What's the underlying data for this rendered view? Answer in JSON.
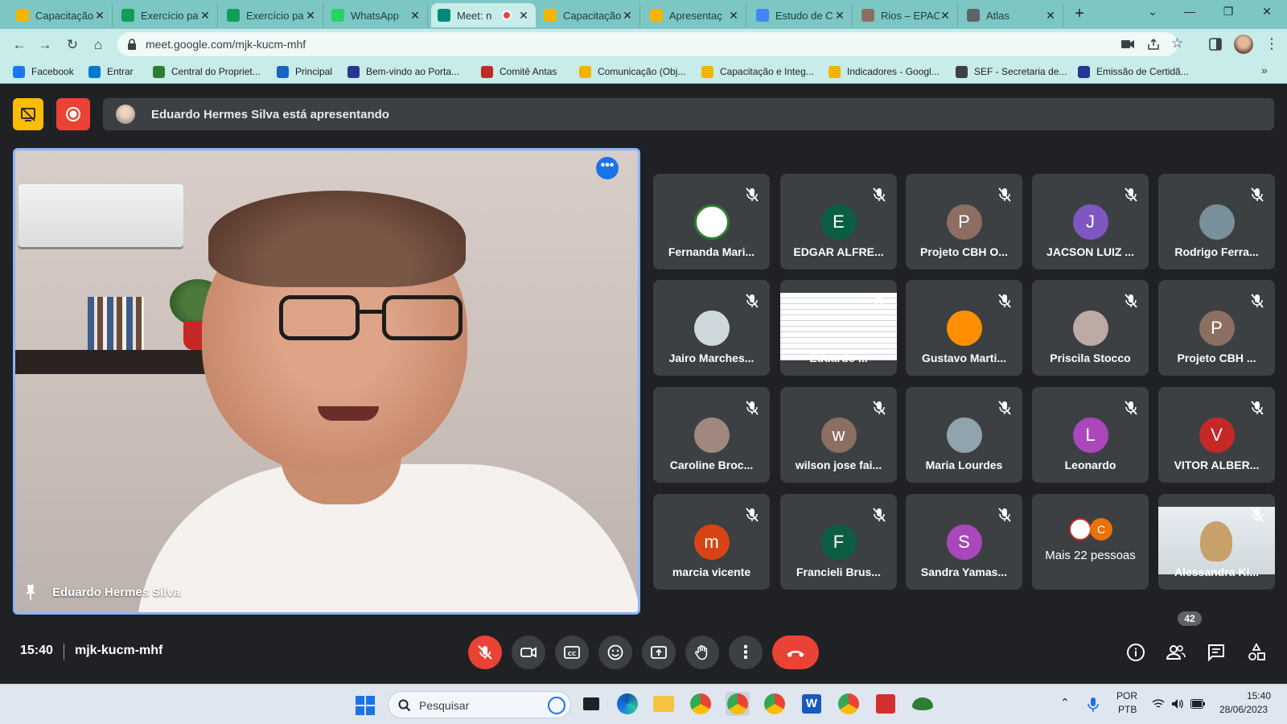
{
  "browser": {
    "tabs": [
      {
        "label": "Capacitação",
        "icon": "google-drive-icon",
        "color": "#f4b400"
      },
      {
        "label": "Exercício pa",
        "icon": "google-sheets-icon",
        "color": "#0f9d58"
      },
      {
        "label": "Exercício pa",
        "icon": "google-sheets-icon",
        "color": "#0f9d58"
      },
      {
        "label": "WhatsApp",
        "icon": "whatsapp-icon",
        "color": "#25d366"
      },
      {
        "label": "Meet: n",
        "icon": "google-meet-icon",
        "color": "#00897b"
      },
      {
        "label": "Capacitação",
        "icon": "google-drive-icon",
        "color": "#f4b400"
      },
      {
        "label": "Apresentaç",
        "icon": "google-slides-icon",
        "color": "#f4b400"
      },
      {
        "label": "Estudo de C",
        "icon": "google-docs-icon",
        "color": "#4285f4"
      },
      {
        "label": "Rios – EPAC",
        "icon": "site-icon",
        "color": "#8d6e63"
      },
      {
        "label": "Atlas",
        "icon": "globe-icon",
        "color": "#5f6368"
      }
    ],
    "url": "meet.google.com/mjk-kucm-mhf",
    "bookmarks": [
      {
        "label": "Facebook",
        "icon": "facebook-icon",
        "color": "#1877f2"
      },
      {
        "label": "Entrar",
        "icon": "outlook-icon",
        "color": "#0078d4"
      },
      {
        "label": "Central do Propriet...",
        "icon": "shield-icon",
        "color": "#2e7d32"
      },
      {
        "label": "Principal",
        "icon": "bird-icon",
        "color": "#1565c0"
      },
      {
        "label": "Bem-vindo ao Porta...",
        "icon": "portal-icon",
        "color": "#283593"
      },
      {
        "label": "Comitê Antas",
        "icon": "antas-icon",
        "color": "#c62828"
      },
      {
        "label": "Comunicação (Obj...",
        "icon": "google-drive-icon",
        "color": "#f4b400"
      },
      {
        "label": "Capacitação e Integ...",
        "icon": "google-drive-icon",
        "color": "#f4b400"
      },
      {
        "label": "Indicadores - Googl...",
        "icon": "google-drive-icon",
        "color": "#f4b400"
      },
      {
        "label": "SEF - Secretaria de...",
        "icon": "globe-icon",
        "color": "#3c4043"
      },
      {
        "label": "Emissão de Certidã...",
        "icon": "certificate-icon",
        "color": "#283593"
      }
    ]
  },
  "meet": {
    "presenting_banner": "Eduardo Hermes Silva está apresentando",
    "main_speaker_name": "Eduardo Hermes Silva",
    "participants": [
      {
        "name": "Fernanda Mari...",
        "initial": "",
        "color": "#ffffff",
        "kind": "logo"
      },
      {
        "name": "EDGAR ALFRE...",
        "initial": "E",
        "color": "#0b5d44",
        "kind": "initial"
      },
      {
        "name": "Projeto CBH O...",
        "initial": "P",
        "color": "#8d6e63",
        "kind": "initial"
      },
      {
        "name": "JACSON LUIZ ...",
        "initial": "J",
        "color": "#7e57c2",
        "kind": "initial"
      },
      {
        "name": "Rodrigo Ferra...",
        "initial": "",
        "color": "#78909c",
        "kind": "photo"
      },
      {
        "name": "Jairo Marches...",
        "initial": "",
        "color": "#cfd8dc",
        "kind": "photo"
      },
      {
        "name": "Eduardo ...",
        "initial": "",
        "color": "#e8eaed",
        "kind": "screen"
      },
      {
        "name": "Gustavo Marti...",
        "initial": "",
        "color": "#ff8f00",
        "kind": "photo"
      },
      {
        "name": "Priscila Stocco",
        "initial": "",
        "color": "#bcaaa4",
        "kind": "photo"
      },
      {
        "name": "Projeto CBH ...",
        "initial": "P",
        "color": "#8d6e63",
        "kind": "initial"
      },
      {
        "name": "Caroline Broc...",
        "initial": "",
        "color": "#a1887f",
        "kind": "photo"
      },
      {
        "name": "wilson jose fai...",
        "initial": "w",
        "color": "#8d6e63",
        "kind": "initial"
      },
      {
        "name": "Maria Lourdes",
        "initial": "",
        "color": "#90a4ae",
        "kind": "photo"
      },
      {
        "name": "Leonardo",
        "initial": "L",
        "color": "#ab47bc",
        "kind": "initial"
      },
      {
        "name": "VITOR ALBER...",
        "initial": "V",
        "color": "#c62828",
        "kind": "initial"
      },
      {
        "name": "marcia vicente",
        "initial": "m",
        "color": "#d84315",
        "kind": "initial"
      },
      {
        "name": "Francieli Brus...",
        "initial": "F",
        "color": "#0b5d44",
        "kind": "initial"
      },
      {
        "name": "Sandra Yamas...",
        "initial": "S",
        "color": "#ab47bc",
        "kind": "initial"
      },
      {
        "name": "Mais 22 pessoas",
        "initial": "C",
        "color": "#e8710a",
        "kind": "more"
      },
      {
        "name": "Alessandra Ki...",
        "initial": "",
        "color": "#dde3ea",
        "kind": "video"
      }
    ],
    "time": "15:40",
    "meeting_code": "mjk-kucm-mhf",
    "people_count": "42"
  },
  "taskbar": {
    "search_placeholder": "Pesquisar",
    "language": "POR",
    "layout": "PTB",
    "time": "15:40",
    "date": "28/06/2023"
  }
}
